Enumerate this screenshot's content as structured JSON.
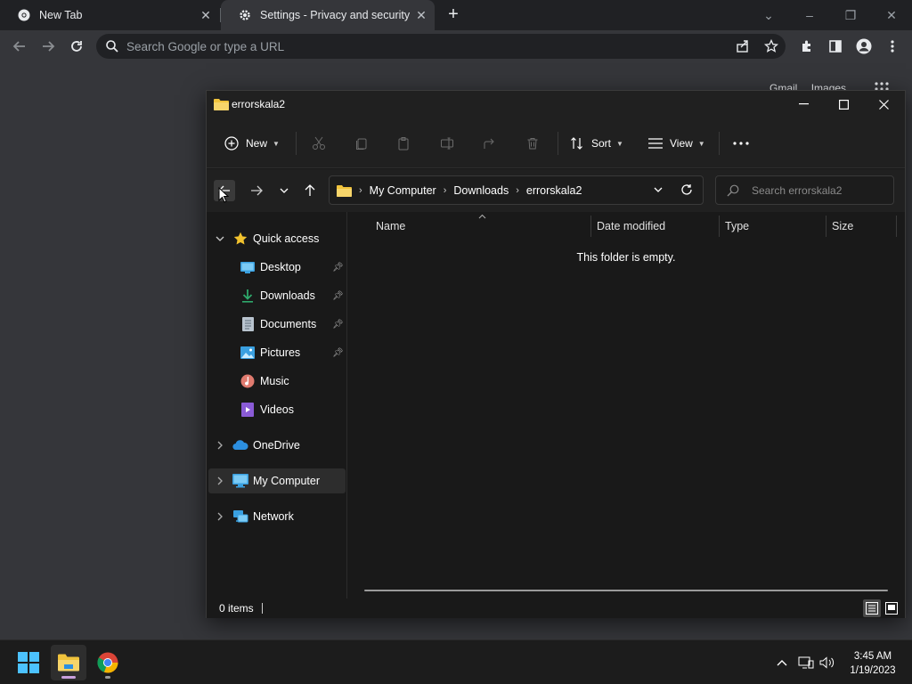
{
  "browser": {
    "tabs": [
      {
        "title": "New Tab",
        "active": false
      },
      {
        "title": "Settings - Privacy and security",
        "active": true
      }
    ],
    "omnibox_placeholder": "Search Google or type a URL",
    "ntp_links": [
      "Gmail",
      "Images"
    ]
  },
  "explorer": {
    "title": "errorskala2",
    "commands": {
      "new_label": "New",
      "sort_label": "Sort",
      "view_label": "View"
    },
    "breadcrumb": [
      "My Computer",
      "Downloads",
      "errorskala2"
    ],
    "search_placeholder": "Search errorskala2",
    "nav": {
      "quick_access": "Quick access",
      "pinned": [
        "Desktop",
        "Downloads",
        "Documents",
        "Pictures"
      ],
      "unpinned": [
        "Music",
        "Videos"
      ],
      "onedrive": "OneDrive",
      "my_computer": "My Computer",
      "network": "Network"
    },
    "columns": [
      "Name",
      "Date modified",
      "Type",
      "Size"
    ],
    "empty_message": "This folder is empty.",
    "status": "0 items"
  },
  "taskbar": {
    "time": "3:45 AM",
    "date": "1/19/2023"
  },
  "colors": {
    "folder_yellow": "#f0c33c",
    "accent_blue": "#0078d4",
    "star_gold": "#f2c22e",
    "chrome_bg": "#35363a"
  }
}
